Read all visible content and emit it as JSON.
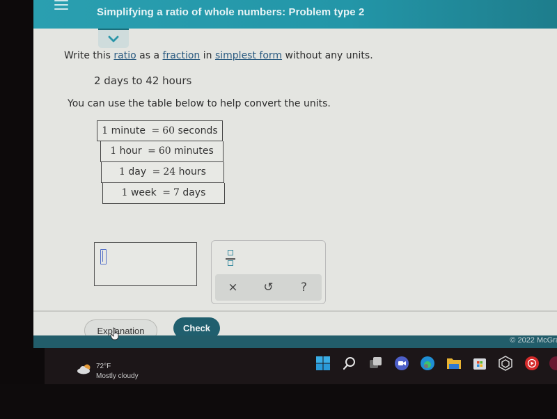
{
  "header": {
    "title": "Simplifying a ratio of whole numbers: Problem type 2",
    "menu_icon": "hamburger-icon",
    "collapse_icon": "chevron-down-icon"
  },
  "problem": {
    "instruction": {
      "part1": "Write this ",
      "link_ratio": "ratio",
      "part2": " as a ",
      "link_fraction": "fraction",
      "part3": " in ",
      "link_simplest_form": "simplest form",
      "part4": " without any units."
    },
    "ratio": "2 days to 42 hours",
    "helper_text": "You can use the table below to help convert the units."
  },
  "conversion_table": [
    {
      "left_num": "1",
      "left_unit": "minute",
      "right_num": "60",
      "right_unit": "seconds"
    },
    {
      "left_num": "1",
      "left_unit": "hour",
      "right_num": "60",
      "right_unit": "minutes"
    },
    {
      "left_num": "1",
      "left_unit": "day",
      "right_num": "24",
      "right_unit": "hours"
    },
    {
      "left_num": "1",
      "left_unit": "week",
      "right_num": "7",
      "right_unit": "days"
    }
  ],
  "answer": {
    "value": "",
    "cursor_icon": "text-cursor-icon"
  },
  "keypad": {
    "fraction_icon": "fraction-icon",
    "clear_label": "×",
    "undo_label": "↺",
    "help_label": "?"
  },
  "actions": {
    "explanation_label": "Explanation",
    "check_label": "Check"
  },
  "footer": {
    "copyright": "© 2022 McGra"
  },
  "taskbar": {
    "weather_temp": "72°F",
    "weather_desc": "Mostly cloudy",
    "icons": [
      "windows-start-icon",
      "search-icon",
      "task-view-icon",
      "teams-chat-icon",
      "edge-browser-icon",
      "file-explorer-icon",
      "microsoft-store-icon",
      "app-icon",
      "youtube-music-icon"
    ]
  },
  "colors": {
    "header_teal": "#2a9fb0",
    "check_button": "#205f6e",
    "footer_bar": "#225d6a",
    "link_blue": "#2a5a80"
  }
}
